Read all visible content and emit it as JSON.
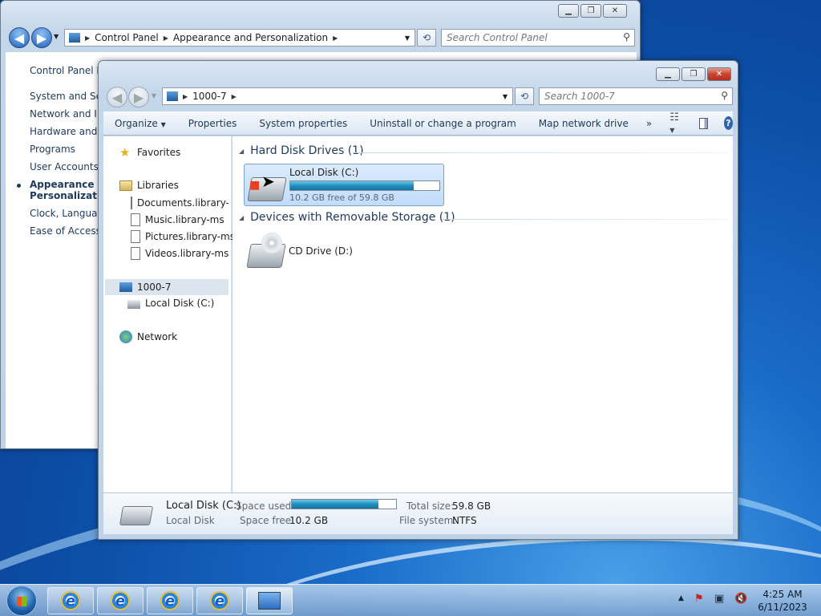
{
  "control_panel": {
    "breadcrumb": [
      "Control Panel",
      "Appearance and Personalization"
    ],
    "search_placeholder": "Search Control Panel",
    "left_nav": [
      "Control Panel H",
      "System and Secu",
      "Network and Int",
      "Hardware and Sc",
      "Programs",
      "User Accounts",
      "Appearance and",
      "Personalization",
      "Clock, Language",
      "Ease of Access"
    ]
  },
  "explorer": {
    "breadcrumb": [
      "1000-7"
    ],
    "search_placeholder": "Search 1000-7",
    "toolbar": {
      "organize": "Organize",
      "properties": "Properties",
      "system_properties": "System properties",
      "uninstall": "Uninstall or change a program",
      "map_drive": "Map network drive",
      "more": "»"
    },
    "nav": {
      "favorites": "Favorites",
      "libraries": "Libraries",
      "lib_items": [
        "Documents.library-ms",
        "Music.library-ms",
        "Pictures.library-ms",
        "Videos.library-ms"
      ],
      "computer": "1000-7",
      "local_disk": "Local Disk (C:)",
      "network": "Network"
    },
    "groups": {
      "hdd_title": "Hard Disk Drives (1)",
      "removable_title": "Devices with Removable Storage (1)"
    },
    "drive_c": {
      "name": "Local Disk (C:)",
      "free_text": "10.2 GB free of 59.8 GB",
      "used_fraction": 0.83
    },
    "drive_d": {
      "name": "CD Drive (D:)"
    },
    "details": {
      "name": "Local Disk (C:)",
      "type": "Local Disk",
      "space_used_label": "Space used:",
      "space_free_label": "Space free:",
      "space_free": "10.2 GB",
      "total_size_label": "Total size:",
      "total_size": "59.8 GB",
      "fs_label": "File system:",
      "fs": "NTFS",
      "used_fraction": 0.83
    }
  },
  "taskbar": {
    "time": "4:25 AM",
    "date": "6/11/2023"
  }
}
